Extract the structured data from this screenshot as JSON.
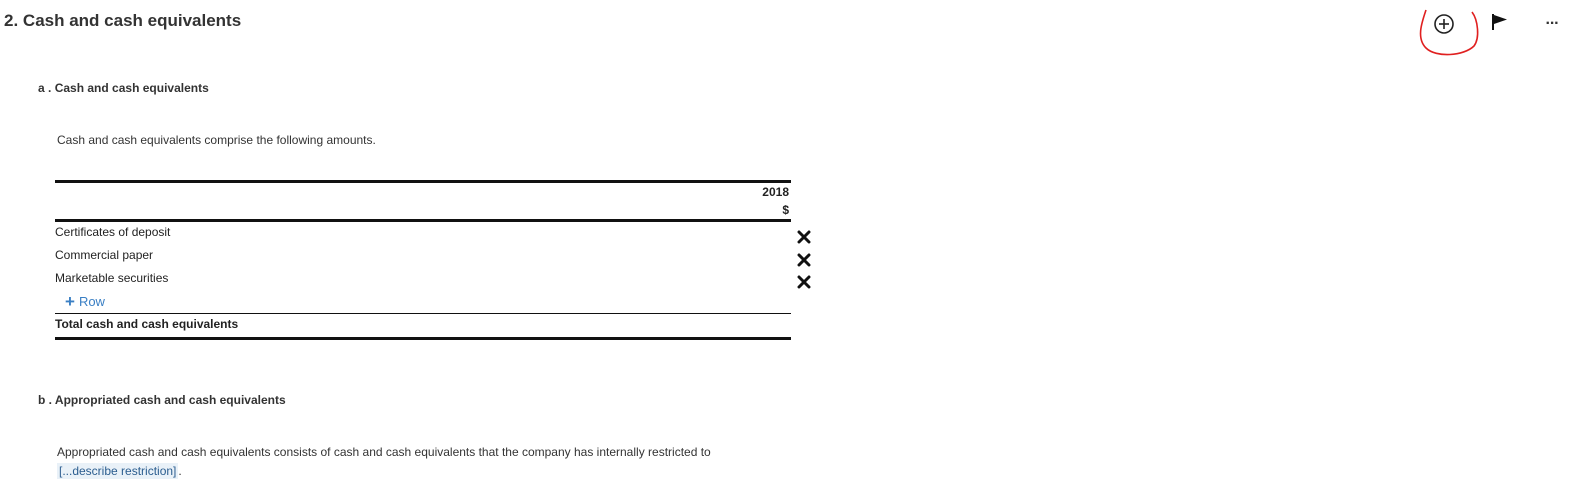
{
  "section": {
    "number": "2",
    "title": "Cash and cash equivalents"
  },
  "header_tools": {
    "add_icon": "circle-plus-icon",
    "flag_icon": "flag-icon",
    "more_label": "···",
    "annotation_color": "#e02020"
  },
  "subsection_a": {
    "letter": "a",
    "title": "Cash and cash equivalents",
    "paragraph": "Cash and cash equivalents comprise the following amounts."
  },
  "table": {
    "column_year": "2018",
    "column_unit": "$",
    "rows": [
      {
        "label": "Certificates of deposit"
      },
      {
        "label": "Commercial paper"
      },
      {
        "label": "Marketable securities"
      }
    ],
    "add_row_label": "Row",
    "total_label": "Total cash and cash equivalents"
  },
  "subsection_b": {
    "letter": "b",
    "title": "Appropriated cash and cash equivalents",
    "paragraph": "Appropriated cash and cash equivalents consists of cash and cash equivalents that the company has internally restricted to",
    "placeholder": "[...describe restriction]",
    "trailing": "."
  },
  "colors": {
    "link": "#3a7fc4",
    "placeholder_bg": "#e9f1f8",
    "text": "#333333"
  }
}
